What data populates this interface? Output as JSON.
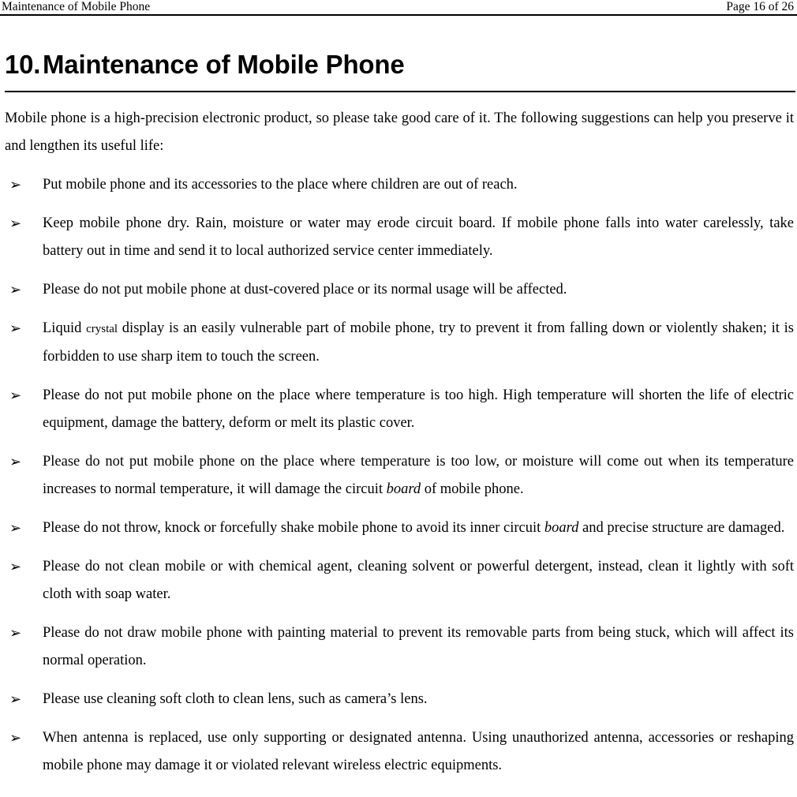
{
  "header": {
    "left_title": "Maintenance of Mobile Phone",
    "right_page_label": "Page 16 of 26"
  },
  "heading": {
    "number": "10.",
    "title": "Maintenance of Mobile Phone"
  },
  "intro": "Mobile phone is a high-precision electronic product, so please take good care of it. The following suggestions can help you preserve it and lengthen its useful life:",
  "bullet_marker": "➢",
  "bullets": [
    {
      "id": "children-out-of-reach",
      "text": "Put mobile phone and its accessories to the place where children are out of reach."
    },
    {
      "id": "keep-dry",
      "text": "Keep mobile phone dry. Rain, moisture or water may erode circuit board. If mobile phone falls into water carelessly, take battery out in time and send it to local authorized service center immediately."
    },
    {
      "id": "avoid-dust",
      "text": "Please do not put mobile phone at dust-covered place or its normal usage will be affected."
    },
    {
      "id": "liquid-crystal-display",
      "text_before": "Liquid ",
      "text_small": "crystal",
      "text_after": " display is an easily vulnerable part of mobile phone, try to prevent it from falling down or violently shaken; it is forbidden to use sharp item to touch the screen."
    },
    {
      "id": "avoid-high-temperature",
      "text": "Please do not put mobile phone on the place where temperature is too high. High temperature will shorten the life of electric equipment, damage the battery, deform or melt its plastic cover."
    },
    {
      "id": "avoid-low-temperature",
      "text_before": "Please do not put mobile phone on the place where temperature is too low, or moisture will come out when its temperature increases to normal temperature, it will damage the circuit ",
      "text_italic": "board",
      "text_after": " of mobile phone."
    },
    {
      "id": "avoid-throw-knock-shake",
      "text_before": "Please do not throw, knock or forcefully shake mobile phone to avoid its inner circuit ",
      "text_italic": "board",
      "text_after": " and precise structure are damaged."
    },
    {
      "id": "avoid-chemical-cleaning",
      "text": "Please do not clean mobile or with chemical agent, cleaning solvent or powerful detergent, instead, clean it lightly with soft cloth with soap water."
    },
    {
      "id": "avoid-painting-material",
      "text": "Please do not draw mobile phone with painting material to prevent its removable parts from being stuck, which will affect its normal operation."
    },
    {
      "id": "clean-lens",
      "text": "Please use cleaning soft cloth to clean lens, such as camera’s lens."
    },
    {
      "id": "antenna-replacement",
      "text": "When antenna is replaced, use only supporting or designated antenna. Using unauthorized antenna, accessories or reshaping mobile phone may damage it or violated relevant wireless electric equipments."
    }
  ]
}
